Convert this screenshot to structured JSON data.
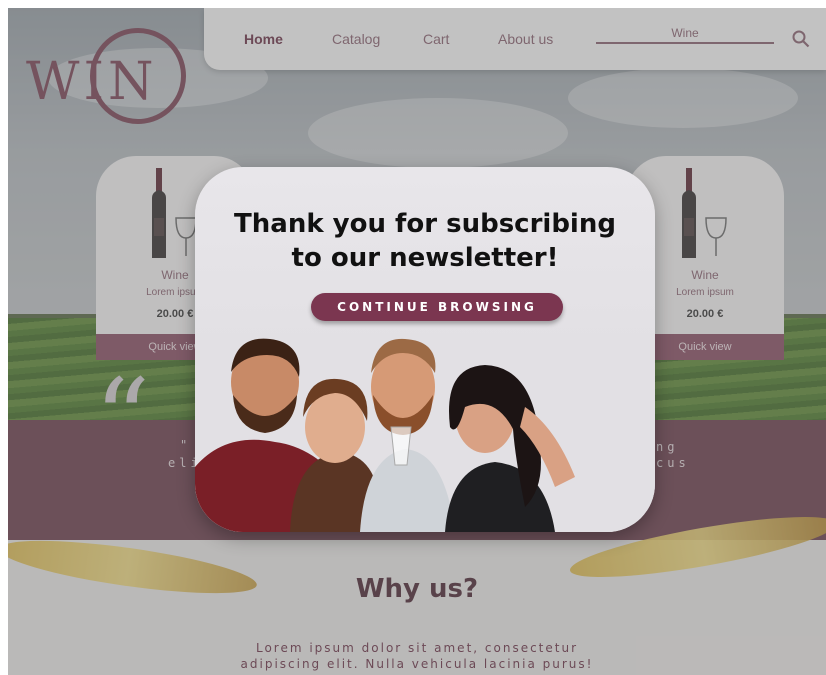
{
  "logo": {
    "text": "WIN"
  },
  "nav": {
    "items": [
      "Home",
      "Catalog",
      "Cart",
      "About us"
    ],
    "active_index": 0
  },
  "search": {
    "value": "Wine"
  },
  "cards": [
    {
      "name": "Wine",
      "desc": "Lorem ipsum",
      "price": "20.00 €",
      "button": "Quick view"
    },
    {
      "name": "Wine",
      "desc": "Lorem ipsum",
      "price": "20.00 €",
      "button": "Quick view"
    }
  ],
  "testimonial": {
    "left_line1": "\"",
    "left_line2": "eli",
    "right_line1": "ng",
    "right_line2": "cus"
  },
  "why": {
    "title": "Why us?",
    "line1": "Lorem ipsum dolor sit amet, consectetur",
    "line2": "adipiscing elit. Nulla vehicula lacinia purus!"
  },
  "modal": {
    "title_line1": "Thank you for subscribing",
    "title_line2": "to our newsletter!",
    "cta": "CONTINUE BROWSING"
  },
  "colors": {
    "brand": "#7b3650",
    "nav_text": "#8b6170",
    "band": "#6b3b4a"
  }
}
